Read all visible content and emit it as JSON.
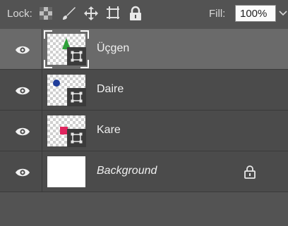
{
  "toolbar": {
    "lock_label": "Lock:",
    "fill_label": "Fill:",
    "fill_value": "100%",
    "icons": [
      "lock-transparent-pixels-icon",
      "lock-image-pixels-icon",
      "lock-position-icon",
      "artboard-autonest-icon",
      "lock-all-icon",
      "chevron-down-icon"
    ]
  },
  "layers": [
    {
      "name": "Üçgen",
      "selected": true,
      "visible": true,
      "shape": "triangle",
      "shape_color": "#2fa13a",
      "smart_object": true
    },
    {
      "name": "Daire",
      "selected": false,
      "visible": true,
      "shape": "circle",
      "shape_color": "#1f3d9a",
      "smart_object": true
    },
    {
      "name": "Kare",
      "selected": false,
      "visible": true,
      "shape": "square",
      "shape_color": "#e0245e",
      "smart_object": true
    },
    {
      "name": "Background",
      "selected": false,
      "visible": true,
      "shape": "none",
      "locked": true,
      "italic": true
    }
  ],
  "colors": {
    "panel_bg": "#535353",
    "layer_bg": "#4b4b4b",
    "selected_bg": "#6a6a6a"
  }
}
